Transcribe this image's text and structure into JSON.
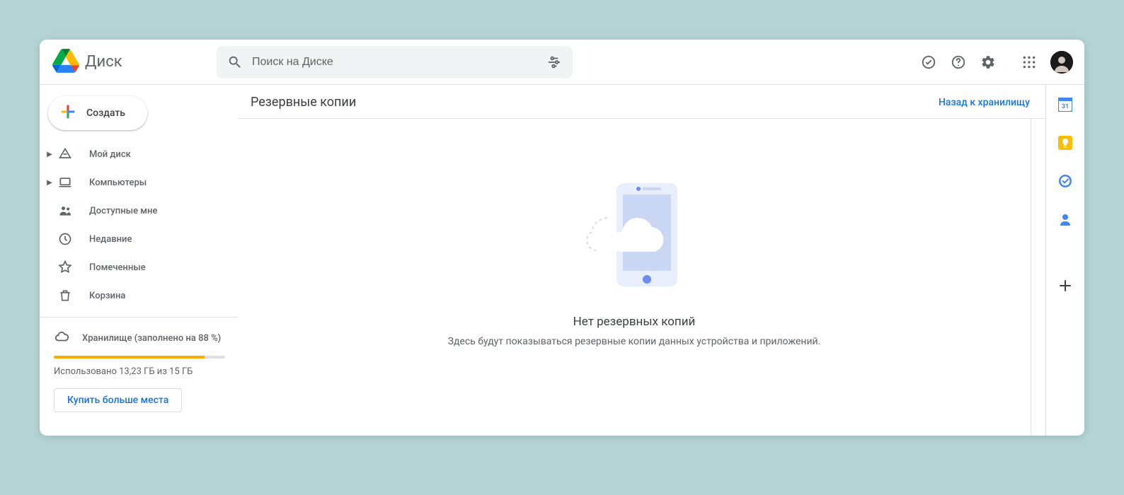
{
  "header": {
    "product_name": "Диск",
    "search_placeholder": "Поиск на Диске"
  },
  "sidebar": {
    "create_label": "Создать",
    "items": [
      {
        "label": "Мой диск",
        "icon": "drive",
        "expandable": true
      },
      {
        "label": "Компьютеры",
        "icon": "laptop",
        "expandable": true
      },
      {
        "label": "Доступные мне",
        "icon": "shared",
        "expandable": false
      },
      {
        "label": "Недавние",
        "icon": "clock",
        "expandable": false
      },
      {
        "label": "Помеченные",
        "icon": "star",
        "expandable": false
      },
      {
        "label": "Корзина",
        "icon": "trash",
        "expandable": false
      }
    ],
    "storage": {
      "label": "Хранилище (заполнено на 88 %)",
      "percent": 88,
      "usage_text": "Использовано 13,23 ГБ из 15 ГБ",
      "buy_label": "Купить больше места"
    }
  },
  "main": {
    "title": "Резервные копии",
    "back_link": "Назад к хранилищу",
    "empty_heading": "Нет резервных копий",
    "empty_sub": "Здесь будут показываться резервные копии данных устройства и приложений."
  },
  "sidepanel": {
    "calendar_day": "31"
  }
}
